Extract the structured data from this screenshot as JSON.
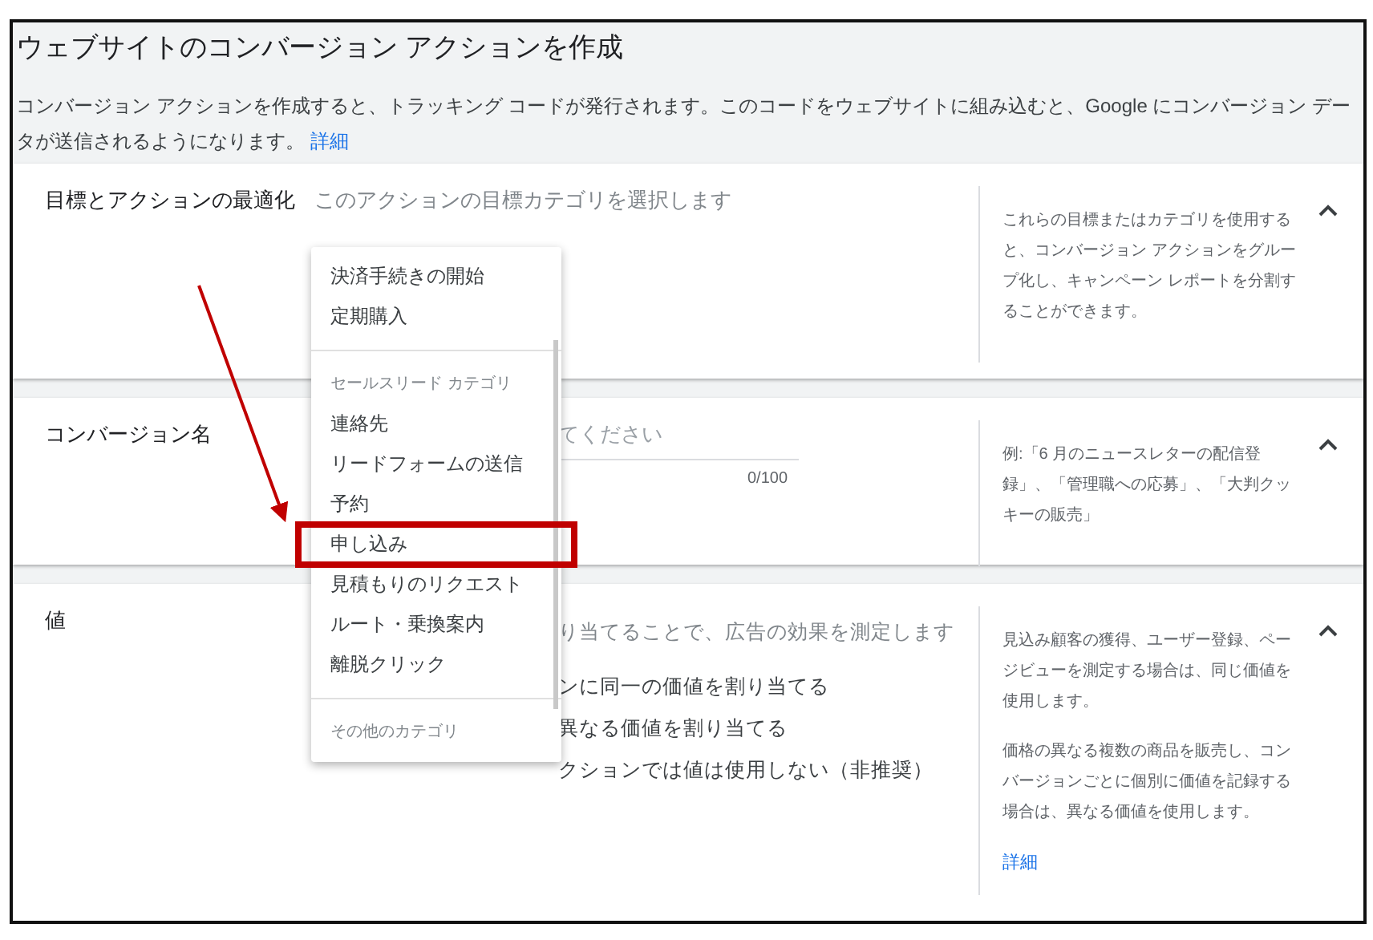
{
  "header": {
    "title": "ウェブサイトのコンバージョン アクションを作成",
    "description": "コンバージョン アクションを作成すると、トラッキング コードが発行されます。このコードをウェブサイトに組み込むと、Google にコンバージョン データが送信されるようになります。",
    "link": "詳細"
  },
  "sections": [
    {
      "kind": "select",
      "label": "目標とアクションの最適化",
      "placeholder": "このアクションの目標カテゴリを選択します",
      "help": [
        "これらの目標またはカテゴリを使用すると、コンバージョン アクションをグループ化し、キャンペーン レポートを分割することができます。"
      ],
      "expanded": true
    },
    {
      "kind": "name",
      "label": "コンバージョン名",
      "placeholder": "てください",
      "counter": "0/100",
      "help": [
        "例:「6 月のニュースレターの配信登録」、「管理職への応募」、「大判クッキーの販売」"
      ],
      "expanded": true
    },
    {
      "kind": "value",
      "label": "値",
      "description": "り当てることで、広告の効果を測定します",
      "options": [
        "ンに同一の価値を割り当てる",
        "異なる価値を割り当てる",
        "クションでは値は使用しない（非推奨）"
      ],
      "help": [
        "見込み顧客の獲得、ユーザー登録、ページビューを測定する場合は、同じ価値を使用します。",
        "価格の異なる複数の商品を販売し、コンバージョンごとに個別に価値を記録する場合は、異なる価値を使用します。"
      ],
      "help_link": "詳細",
      "expanded": true
    }
  ],
  "menu": [
    {
      "kind": "item",
      "label": "決済手続きの開始",
      "annotated": false
    },
    {
      "kind": "item",
      "label": "定期購入",
      "annotated": false
    },
    {
      "kind": "divider"
    },
    {
      "kind": "header",
      "label": "セールスリード カテゴリ"
    },
    {
      "kind": "item",
      "label": "連絡先",
      "annotated": false
    },
    {
      "kind": "item",
      "label": "リードフォームの送信",
      "annotated": false
    },
    {
      "kind": "item",
      "label": "予約",
      "annotated": false
    },
    {
      "kind": "item",
      "label": "申し込み",
      "annotated": true
    },
    {
      "kind": "item",
      "label": "見積もりのリクエスト",
      "annotated": false
    },
    {
      "kind": "item",
      "label": "ルート・乗換案内",
      "annotated": false
    },
    {
      "kind": "item",
      "label": "離脱クリック",
      "annotated": false
    },
    {
      "kind": "divider"
    },
    {
      "kind": "header",
      "label": "その他のカテゴリ"
    }
  ]
}
